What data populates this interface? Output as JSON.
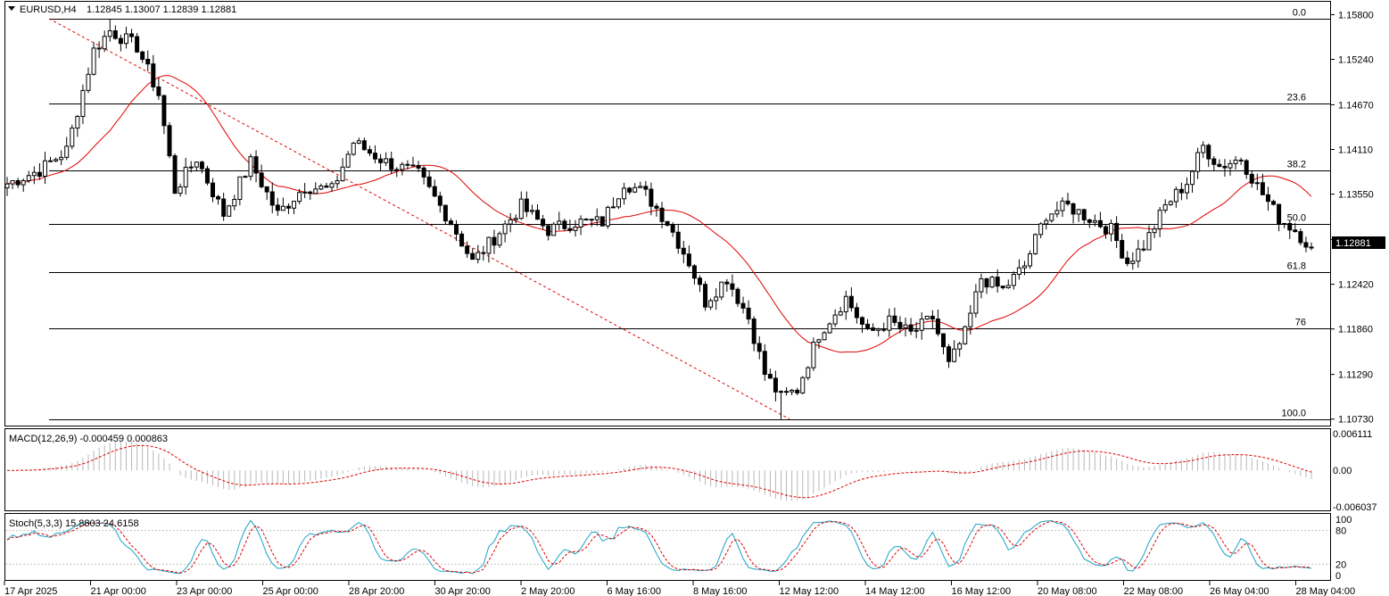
{
  "header": {
    "symbol": "EURUSD,H4",
    "ohlc": "1.12845 1.13007 1.12839 1.12881"
  },
  "price_axis": {
    "ticks": [
      "1.15800",
      "1.15240",
      "1.14670",
      "1.14110",
      "1.13550",
      "1.12980",
      "1.12420",
      "1.11860",
      "1.11290",
      "1.10730"
    ],
    "current_price": "1.12881"
  },
  "fibonacci": {
    "levels": [
      {
        "label": "0.0",
        "price": 1.1575
      },
      {
        "label": "23.6",
        "price": 1.1469
      },
      {
        "label": "38.2",
        "price": 1.1385
      },
      {
        "label": "50.0",
        "price": 1.1318
      },
      {
        "label": "61.8",
        "price": 1.1257
      },
      {
        "label": "76",
        "price": 1.1187
      },
      {
        "label": "100.0",
        "price": 1.1073
      }
    ]
  },
  "macd": {
    "label": "MACD(12,26,9) -0.000459 0.000863",
    "ticks": [
      "0.006111",
      "0.00",
      "-0.006037"
    ]
  },
  "stoch": {
    "label": "Stoch(5,3,3) 15.8803 24.6158",
    "ticks": [
      "100",
      "80",
      "20",
      "0"
    ]
  },
  "time_axis": {
    "labels": [
      "17 Apr 2025",
      "21 Apr 00:00",
      "23 Apr 00:00",
      "25 Apr 00:00",
      "28 Apr 20:00",
      "30 Apr 20:00",
      "2 May 20:00",
      "6 May 16:00",
      "8 May 16:00",
      "12 May 12:00",
      "14 May 12:00",
      "16 May 12:00",
      "20 May 08:00",
      "22 May 08:00",
      "26 May 04:00",
      "28 May 04:00"
    ]
  },
  "colors": {
    "background": "#ffffff",
    "candle_bull": "#ffffff",
    "candle_bear": "#000000",
    "ma_line": "#e00000",
    "signal_line": "#e00000",
    "stoch_main": "#1aa3c4",
    "macd_hist": "#b8b8b8"
  },
  "chart_data": {
    "type": "candlestick",
    "symbol": "EURUSD",
    "timeframe": "H4",
    "ylim": [
      1.1066,
      1.1595
    ],
    "anchors": [
      {
        "i": 0,
        "p": 1.1368
      },
      {
        "i": 6,
        "p": 1.1385
      },
      {
        "i": 11,
        "p": 1.141
      },
      {
        "i": 16,
        "p": 1.1535
      },
      {
        "i": 19,
        "p": 1.156
      },
      {
        "i": 24,
        "p": 1.154
      },
      {
        "i": 28,
        "p": 1.148
      },
      {
        "i": 31,
        "p": 1.136
      },
      {
        "i": 35,
        "p": 1.14
      },
      {
        "i": 40,
        "p": 1.133
      },
      {
        "i": 45,
        "p": 1.1395
      },
      {
        "i": 50,
        "p": 1.133
      },
      {
        "i": 55,
        "p": 1.1365
      },
      {
        "i": 60,
        "p": 1.136
      },
      {
        "i": 64,
        "p": 1.142
      },
      {
        "i": 70,
        "p": 1.1395
      },
      {
        "i": 76,
        "p": 1.138
      },
      {
        "i": 82,
        "p": 1.132
      },
      {
        "i": 86,
        "p": 1.127
      },
      {
        "i": 90,
        "p": 1.13
      },
      {
        "i": 95,
        "p": 1.134
      },
      {
        "i": 100,
        "p": 1.131
      },
      {
        "i": 105,
        "p": 1.132
      },
      {
        "i": 110,
        "p": 1.132
      },
      {
        "i": 114,
        "p": 1.137
      },
      {
        "i": 118,
        "p": 1.1355
      },
      {
        "i": 122,
        "p": 1.132
      },
      {
        "i": 126,
        "p": 1.127
      },
      {
        "i": 129,
        "p": 1.122
      },
      {
        "i": 133,
        "p": 1.125
      },
      {
        "i": 137,
        "p": 1.12
      },
      {
        "i": 140,
        "p": 1.113
      },
      {
        "i": 143,
        "p": 1.11
      },
      {
        "i": 146,
        "p": 1.111
      },
      {
        "i": 150,
        "p": 1.118
      },
      {
        "i": 155,
        "p": 1.1225
      },
      {
        "i": 159,
        "p": 1.118
      },
      {
        "i": 163,
        "p": 1.1195
      },
      {
        "i": 167,
        "p": 1.118
      },
      {
        "i": 171,
        "p": 1.12
      },
      {
        "i": 174,
        "p": 1.114
      },
      {
        "i": 177,
        "p": 1.118
      },
      {
        "i": 180,
        "p": 1.125
      },
      {
        "i": 184,
        "p": 1.1235
      },
      {
        "i": 188,
        "p": 1.1265
      },
      {
        "i": 192,
        "p": 1.133
      },
      {
        "i": 196,
        "p": 1.134
      },
      {
        "i": 200,
        "p": 1.1325
      },
      {
        "i": 204,
        "p": 1.131
      },
      {
        "i": 207,
        "p": 1.127
      },
      {
        "i": 210,
        "p": 1.129
      },
      {
        "i": 214,
        "p": 1.134
      },
      {
        "i": 218,
        "p": 1.137
      },
      {
        "i": 221,
        "p": 1.1415
      },
      {
        "i": 224,
        "p": 1.139
      },
      {
        "i": 228,
        "p": 1.14
      },
      {
        "i": 231,
        "p": 1.1365
      },
      {
        "i": 235,
        "p": 1.1325
      },
      {
        "i": 238,
        "p": 1.131
      },
      {
        "i": 241,
        "p": 1.1288
      }
    ],
    "series": [
      {
        "name": "MACD(12,26,9)",
        "last": -0.000459,
        "signal": 0.000863
      },
      {
        "name": "Stoch(5,3,3)",
        "main": 15.8803,
        "signal": 24.6158
      }
    ]
  }
}
